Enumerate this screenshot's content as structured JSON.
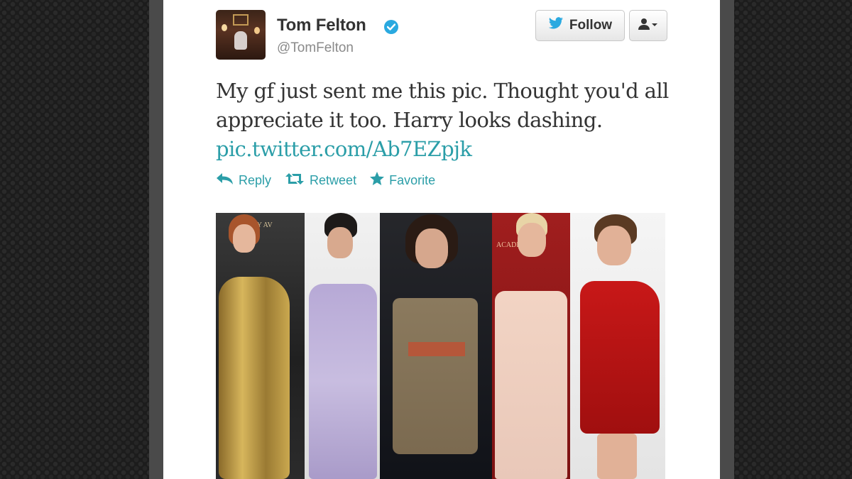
{
  "tweet": {
    "author_name": "Tom Felton",
    "handle": "@TomFelton",
    "text": "My gf just sent me this pic. Thought you'd all appreciate it too. Harry looks dashing.",
    "link": "pic.twitter.com/Ab7EZpjk"
  },
  "buttons": {
    "follow_label": "Follow"
  },
  "actions": {
    "reply_label": "Reply",
    "retweet_label": "Retweet",
    "favorite_label": "Favorite"
  },
  "photo": {
    "panel_1_sign": "MMY AV",
    "panel_4_sign": "ACADEM"
  },
  "icons": {
    "verified": "verified-badge-icon",
    "twitter_bird": "twitter-bird-icon",
    "user_menu": "user-dropdown-icon",
    "reply": "reply-arrow-icon",
    "retweet": "retweet-icon",
    "favorite": "star-icon"
  },
  "colors": {
    "link": "#2b9ea8",
    "verified": "#2aa9e0",
    "text": "#333333"
  }
}
